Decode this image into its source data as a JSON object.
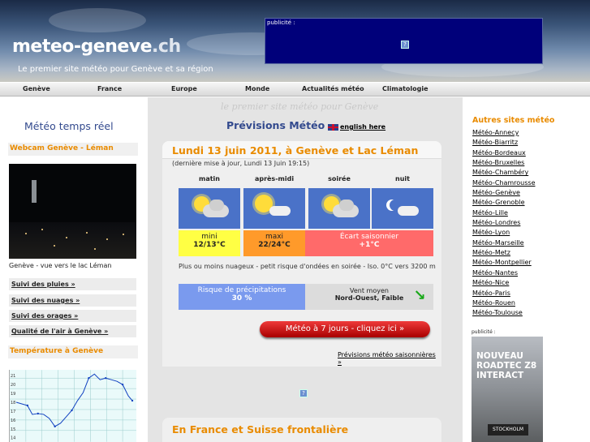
{
  "header": {
    "logo_main": "meteo-geneve",
    "logo_ext": ".ch",
    "tagline": "Le premier site météo pour Genève et sa région",
    "pub_label": "publicité :"
  },
  "nav": [
    "Genève",
    "France",
    "Europe",
    "Monde",
    "Actualités météo",
    "Climatologie"
  ],
  "left": {
    "title": "Météo temps réel",
    "webcam_title": "Webcam Genève - Léman",
    "webcam_caption": "Genève - vue vers le lac Léman",
    "links": [
      "Suivi des pluies »",
      "Suivi des nuages »",
      "Suivi des orages »",
      "Qualité de l'air à Genève »"
    ],
    "temp_title": "Température à Genève",
    "graph_yticks": [
      "21",
      "20",
      "19",
      "18",
      "17",
      "16",
      "15",
      "14"
    ]
  },
  "center": {
    "subtitle": "le premier site météo pour Genève",
    "title": "Prévisions Météo",
    "english_link": "english here",
    "card_title": "Lundi 13 juin 2011, à Genève et Lac Léman",
    "updated": "(dernière mise à jour, Lundi 13 Juin 19:15)",
    "periods": [
      "matin",
      "après-midi",
      "soirée",
      "nuit"
    ],
    "mini_label": "mini",
    "mini_value": "12/13°C",
    "maxi_label": "maxi",
    "maxi_value": "22/24°C",
    "ecart_label": "Écart saisonnier",
    "ecart_value": "+1°C",
    "description": "Plus ou moins nuageux - petit risque d'ondées en soirée - Iso. 0°C vers 3200 m",
    "precip_label": "Risque de précipitations",
    "precip_value": "30 %",
    "vent_label": "Vent moyen",
    "vent_value": "Nord-Ouest, Faible",
    "button_7days": "Météo à 7 jours - cliquez ici »",
    "seasonal_link": "Prévisions météo saisonnières »",
    "card2_title": "En France et Suisse frontalière"
  },
  "right": {
    "title": "Autres sites météo",
    "links": [
      "Météo-Annecy",
      "Météo-Biarritz",
      "Météo-Bordeaux",
      "Météo-Bruxelles",
      "Météo-Chambéry",
      "Météo-Chamrousse",
      "Météo-Genève",
      "Météo-Grenoble",
      "Météo-Lille",
      "Météo-Londres",
      "Météo-Lyon",
      "Météo-Marseille",
      "Météo-Metz",
      "Météo-Montpellier",
      "Météo-Nantes",
      "Météo-Nice",
      "Météo-Paris",
      "Météo-Rouen",
      "Météo-Toulouse"
    ],
    "pub_label": "publicité :",
    "ad_text": "NOUVEAU ROADTEC Z8 INTERACT",
    "ad_sign": "STOCKHOLM"
  },
  "colors": {
    "accent": "#e98b00",
    "title_blue": "#334a8e",
    "mini": "#ffff44",
    "maxi": "#ff9a2a",
    "ecart": "#ff6a6a",
    "precip": "#7a9aee"
  }
}
